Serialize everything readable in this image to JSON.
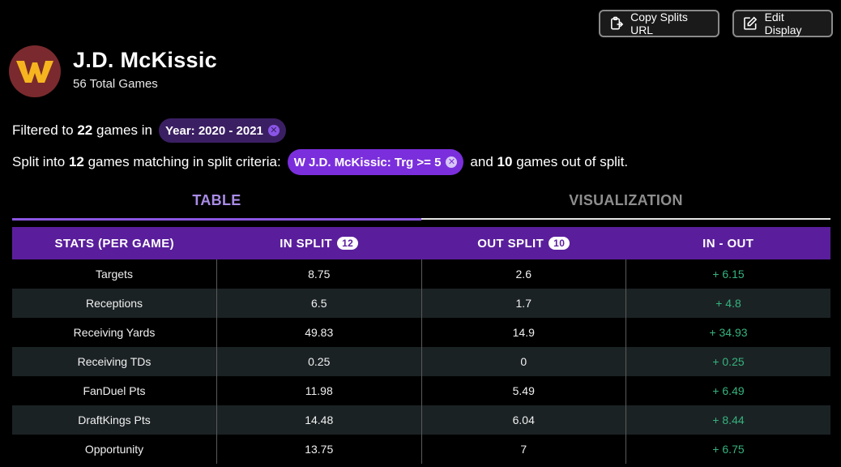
{
  "toolbar": {
    "copy_label": "Copy Splits URL",
    "edit_label": "Edit Display"
  },
  "player": {
    "logo_letter": "W",
    "name": "J.D. McKissic",
    "total_games": "56 Total Games"
  },
  "filter": {
    "prefix": "Filtered to",
    "count": "22",
    "suffix": "games in",
    "chip_label": "Year: 2020 - 2021"
  },
  "split": {
    "prefix": "Split into",
    "in_count": "12",
    "middle": "games matching in split criteria:",
    "chip_label": "W J.D. McKissic: Trg >= 5",
    "and_text": "and",
    "out_count": "10",
    "suffix": "games out of split."
  },
  "tabs": {
    "table": "TABLE",
    "visualization": "VISUALIZATION"
  },
  "table": {
    "headers": {
      "stats": "STATS (PER GAME)",
      "in_split": "IN SPLIT",
      "in_badge": "12",
      "out_split": "OUT SPLIT",
      "out_badge": "10",
      "diff": "IN - OUT"
    },
    "rows": [
      {
        "stat": "Targets",
        "in": "8.75",
        "out": "2.6",
        "diff": "+ 6.15"
      },
      {
        "stat": "Receptions",
        "in": "6.5",
        "out": "1.7",
        "diff": "+ 4.8"
      },
      {
        "stat": "Receiving Yards",
        "in": "49.83",
        "out": "14.9",
        "diff": "+ 34.93"
      },
      {
        "stat": "Receiving TDs",
        "in": "0.25",
        "out": "0",
        "diff": "+ 0.25"
      },
      {
        "stat": "FanDuel Pts",
        "in": "11.98",
        "out": "5.49",
        "diff": "+ 6.49"
      },
      {
        "stat": "DraftKings Pts",
        "in": "14.48",
        "out": "6.04",
        "diff": "+ 8.44"
      },
      {
        "stat": "Opportunity",
        "in": "13.75",
        "out": "7",
        "diff": "+ 6.75"
      }
    ]
  },
  "colors": {
    "accent": "#5a1e9c",
    "positive": "#35b37e",
    "team_bg": "#7a2a2e",
    "team_fg": "#f6b51e"
  }
}
